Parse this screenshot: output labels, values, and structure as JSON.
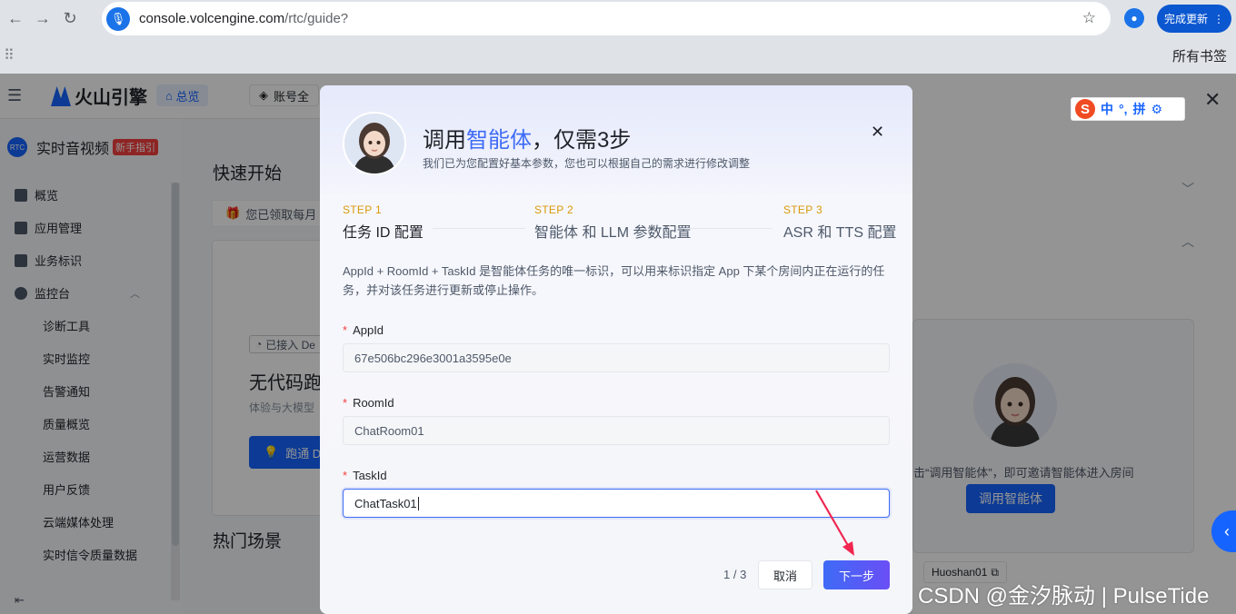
{
  "browser": {
    "url_host": "console.volcengine.com",
    "url_path": "/rtc/guide?",
    "update_button": "完成更新",
    "bookmarks_label": "所有书签"
  },
  "console": {
    "brand": "火山引擎",
    "overview_tab": "总览",
    "account_tab": "账号全",
    "product": "实时音视频",
    "product_badge": "新手指引",
    "sidebar": [
      "概览",
      "应用管理",
      "业务标识",
      "监控台"
    ],
    "monitor_children": [
      "诊断工具",
      "实时监控",
      "告警通知",
      "质量概览",
      "运营数据",
      "用户反馈",
      "云端媒体处理",
      "实时信令质量数据"
    ],
    "quick_start": "快速开始",
    "notice": "您已领取每月",
    "demo_tag": "已接入 De",
    "card_title": "无代码跑",
    "card_sub": "体验与大模型",
    "card_button": "跑通 D",
    "hot_scenes": "热门场景",
    "ime": {
      "lang": "中",
      "punct": "°,",
      "mode": "拼"
    },
    "agent_hint": "击“调用智能体”，即可邀请智能体进入房间",
    "agent_call_button": "调用智能体",
    "room_tag": "Huoshan01"
  },
  "modal": {
    "title_pre": "调用",
    "title_hl": "智能体",
    "title_post": "，仅需3步",
    "subtitle": "我们已为您配置好基本参数，您也可以根据自己的需求进行修改调整",
    "steps": [
      {
        "no": "STEP 1",
        "name": "任务 ID 配置"
      },
      {
        "no": "STEP 2",
        "name": "智能体 和 LLM 参数配置"
      },
      {
        "no": "STEP 3",
        "name": "ASR 和 TTS 配置"
      }
    ],
    "description": "AppId + RoomId + TaskId 是智能体任务的唯一标识，可以用来标识指定 App 下某个房间内正在运行的任务，并对该任务进行更新或停止操作。",
    "fields": [
      {
        "label": "AppId",
        "value": "67e506bc296e3001a3595e0e"
      },
      {
        "label": "RoomId",
        "value": "ChatRoom01"
      },
      {
        "label": "TaskId",
        "value": "ChatTask01"
      }
    ],
    "pager": "1 / 3",
    "cancel": "取消",
    "next": "下一步"
  },
  "watermark": "CSDN @金汐脉动 | PulseTide",
  "colors": {
    "accent": "#3e6bf6",
    "step_label": "#d99a0a",
    "required": "#f53f3f",
    "arrow": "#f0264f"
  }
}
